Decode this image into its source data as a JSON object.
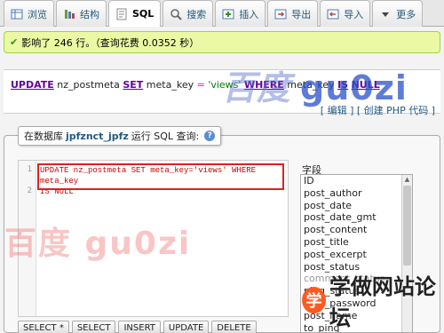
{
  "tabs": [
    {
      "label": "浏览",
      "icon": "table-icon"
    },
    {
      "label": "结构",
      "icon": "structure-icon"
    },
    {
      "label": "SQL",
      "icon": "sql-icon"
    },
    {
      "label": "搜索",
      "icon": "search-icon"
    },
    {
      "label": "插入",
      "icon": "insert-icon"
    },
    {
      "label": "导出",
      "icon": "export-icon"
    },
    {
      "label": "导入",
      "icon": "import-icon"
    },
    {
      "label": "更多",
      "icon": "chevron-down-icon"
    }
  ],
  "success": {
    "text": "影响了 246 行。（查询花费 0.0352 秒）"
  },
  "result": {
    "sql_parts": [
      "UPDATE",
      " nz_postmeta ",
      "SET",
      " meta_key ",
      "=",
      " 'views' ",
      "WHERE",
      " meta_key ",
      "IS",
      " ",
      "NULL"
    ],
    "edit_link": "编辑",
    "php_link": "创建 PHP 代码"
  },
  "watermark_top": {
    "left": "百度",
    "right": "gu0zi"
  },
  "query_panel": {
    "legend_prefix": "在数据库",
    "db_name": "jpfznct_jpfz",
    "legend_suffix": "运行 SQL 查询:",
    "code_line1": "UPDATE nz_postmeta SET meta_key='views' WHERE meta_key",
    "code_line1b": "IS NULL",
    "line_numbers": [
      "1",
      "2"
    ],
    "watermark": "百度 gu0zi",
    "field_label": "字段",
    "fields": [
      "ID",
      "post_author",
      "post_date",
      "post_date_gmt",
      "post_content",
      "post_title",
      "post_excerpt",
      "post_status",
      "comment_status",
      "ping_status",
      "post_password",
      "post_name",
      "to_ping"
    ],
    "buttons": [
      "SELECT *",
      "SELECT",
      "INSERT",
      "UPDATE",
      "DELETE"
    ]
  },
  "brand_watermark": {
    "badge": "学",
    "text": "学做网站论坛"
  },
  "colors": {
    "accent": "#235a81",
    "success_bg": "#ebf8a4",
    "highlight": "#e02020"
  }
}
